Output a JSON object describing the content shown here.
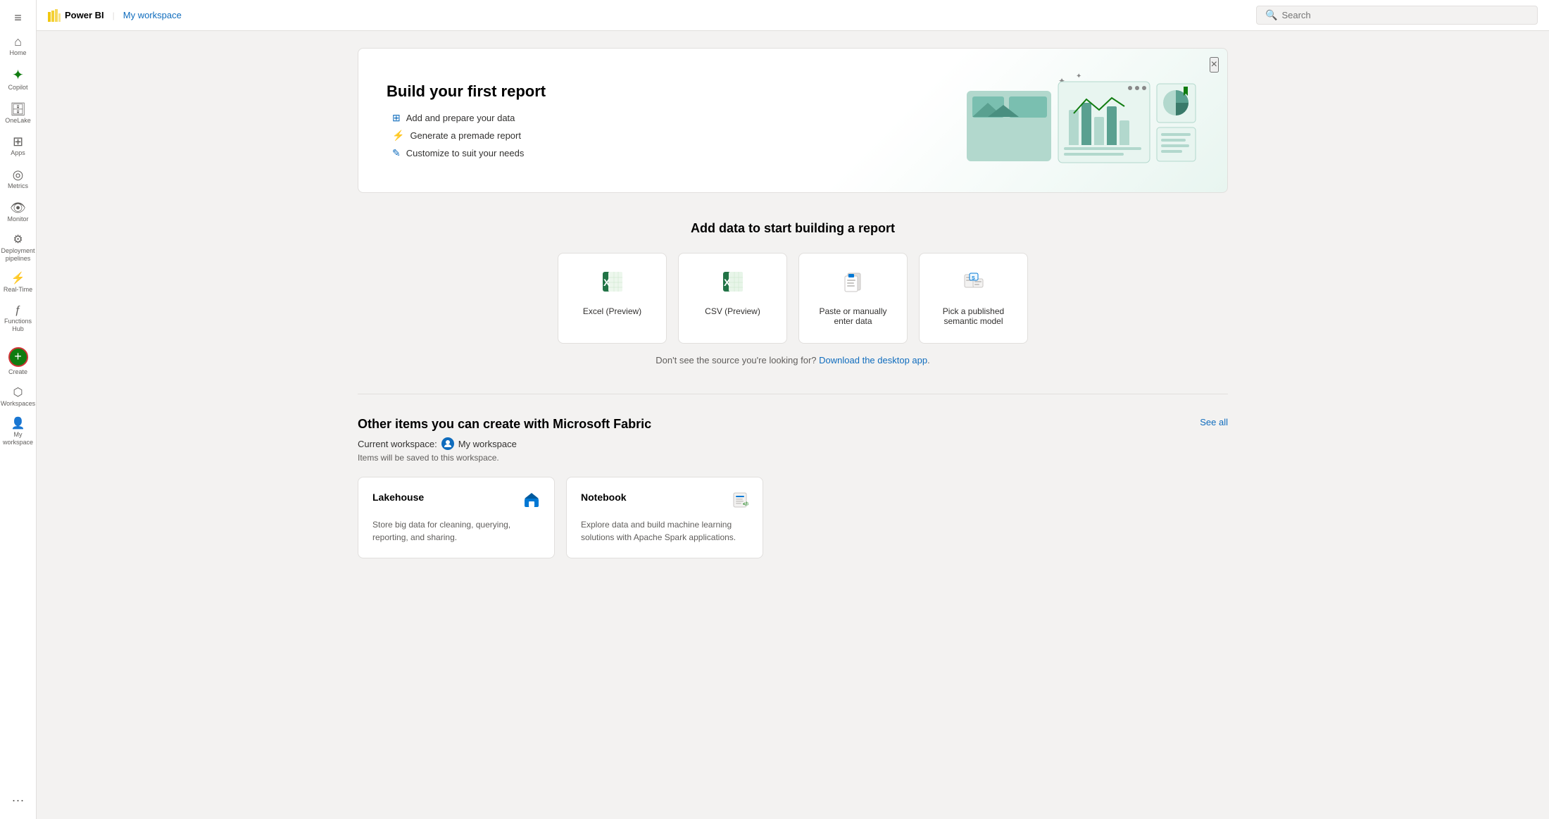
{
  "app": {
    "name": "Power BI",
    "workspace": "My workspace"
  },
  "topbar": {
    "search_placeholder": "Search"
  },
  "sidebar": {
    "items": [
      {
        "id": "menu",
        "label": "",
        "icon": "⊞"
      },
      {
        "id": "home",
        "label": "Home",
        "icon": "🏠"
      },
      {
        "id": "copilot",
        "label": "Copilot",
        "icon": "✦"
      },
      {
        "id": "onelake",
        "label": "OneLake",
        "icon": "🗄"
      },
      {
        "id": "apps",
        "label": "Apps",
        "icon": "⊡"
      },
      {
        "id": "metrics",
        "label": "Metrics",
        "icon": "📊"
      },
      {
        "id": "monitor",
        "label": "Monitor",
        "icon": "👁"
      },
      {
        "id": "deployment",
        "label": "Deployment pipelines",
        "icon": "⚙"
      },
      {
        "id": "realtime",
        "label": "Real-Time",
        "icon": "⚡"
      },
      {
        "id": "functions",
        "label": "Functions Hub",
        "icon": "ƒ"
      },
      {
        "id": "create",
        "label": "Create",
        "icon": "+"
      },
      {
        "id": "workspaces",
        "label": "Workspaces",
        "icon": "⬡"
      },
      {
        "id": "myworkspace",
        "label": "My workspace",
        "icon": "👤"
      }
    ]
  },
  "hero": {
    "title": "Build your first report",
    "bullets": [
      {
        "icon": "⊞",
        "text": "Add and prepare your data"
      },
      {
        "icon": "⚡",
        "text": "Generate a premade report"
      },
      {
        "icon": "✎",
        "text": "Customize to suit your needs"
      }
    ],
    "close_label": "×"
  },
  "add_data": {
    "title": "Add data to start building a report",
    "cards": [
      {
        "id": "excel",
        "icon": "📗",
        "label": "Excel (Preview)"
      },
      {
        "id": "csv",
        "icon": "📗",
        "label": "CSV (Preview)"
      },
      {
        "id": "paste",
        "icon": "📋",
        "label": "Paste or manually enter data"
      },
      {
        "id": "semantic",
        "icon": "📦",
        "label": "Pick a published semantic model"
      }
    ],
    "hint_text": "Don't see the source you're looking for?",
    "hint_link": "Download the desktop app",
    "hint_suffix": "."
  },
  "other": {
    "title": "Other items you can create with Microsoft Fabric",
    "see_all": "See all",
    "current_workspace_label": "Current workspace:",
    "workspace_name": "My workspace",
    "workspace_note": "Items will be saved to this workspace.",
    "cards": [
      {
        "id": "lakehouse",
        "title": "Lakehouse",
        "icon": "🏠",
        "description": "Store big data for cleaning, querying, reporting, and sharing."
      },
      {
        "id": "notebook",
        "title": "Notebook",
        "icon": "📓",
        "description": "Explore data and build machine learning solutions with Apache Spark applications."
      }
    ]
  }
}
